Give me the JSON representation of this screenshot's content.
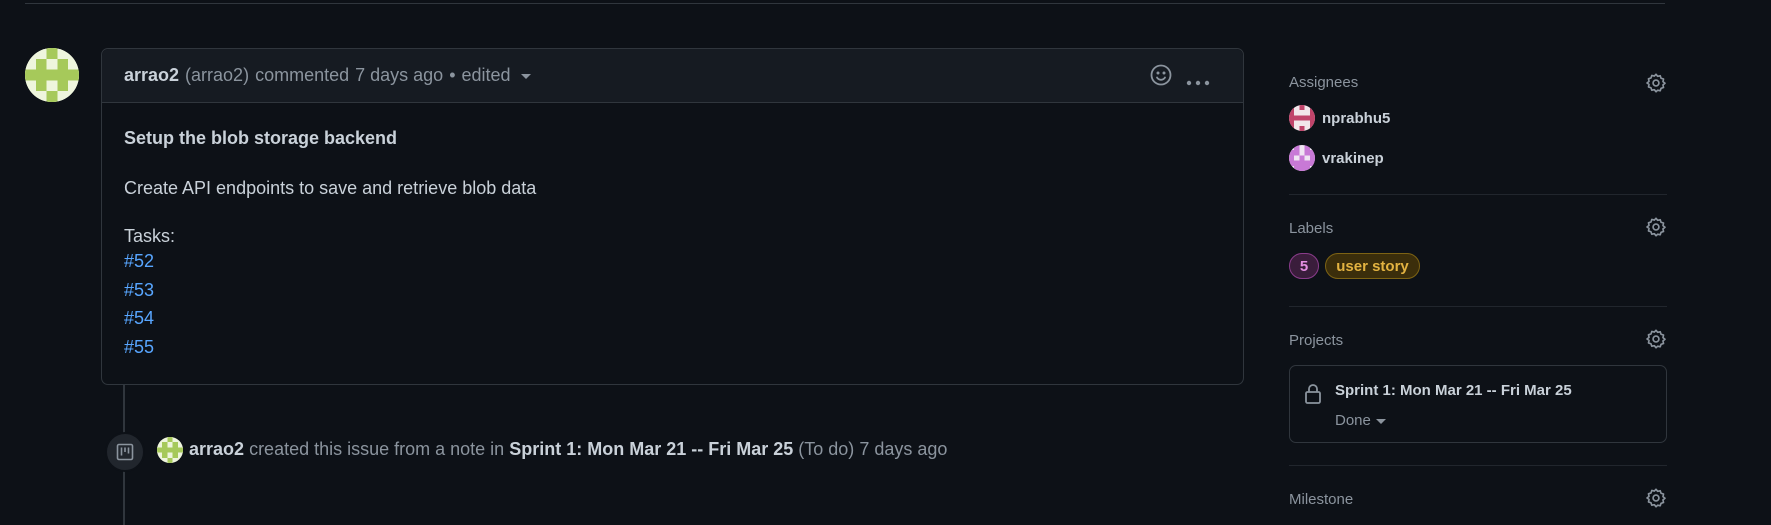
{
  "comment": {
    "author": "arrao2",
    "author_handle": "(arrao2)",
    "action": "commented",
    "time": "7 days ago",
    "separator": "•",
    "edited": "edited",
    "body_title": "Setup the blob storage backend",
    "body_text": "Create API endpoints to save and retrieve blob data",
    "tasks_label": "Tasks:",
    "tasks": [
      "#52",
      "#53",
      "#54",
      "#55"
    ]
  },
  "event": {
    "author": "arrao2",
    "text_before": "created this issue from a note in",
    "project": "Sprint 1: Mon Mar 21 -- Fri Mar 25",
    "column": "(To do)",
    "time": "7 days ago"
  },
  "sidebar": {
    "assignees": {
      "title": "Assignees",
      "people": [
        "nprabhu5",
        "vrakinep"
      ]
    },
    "labels": {
      "title": "Labels",
      "items": [
        {
          "text": "5",
          "color": "#d25fd0"
        },
        {
          "text": "user story",
          "color": "#e3b341"
        }
      ]
    },
    "projects": {
      "title": "Projects",
      "project_name": "Sprint 1: Mon Mar 21 -- Fri Mar 25",
      "status": "Done"
    },
    "milestone": {
      "title": "Milestone"
    }
  },
  "colors": {
    "background": "#0d1117",
    "link": "#58a6ff",
    "muted": "#8b949e",
    "border": "#30363d"
  },
  "icons": [
    "smiley-icon",
    "kebab-menu-icon",
    "project-board-icon",
    "gear-icon",
    "lock-icon",
    "caret-down-icon"
  ]
}
